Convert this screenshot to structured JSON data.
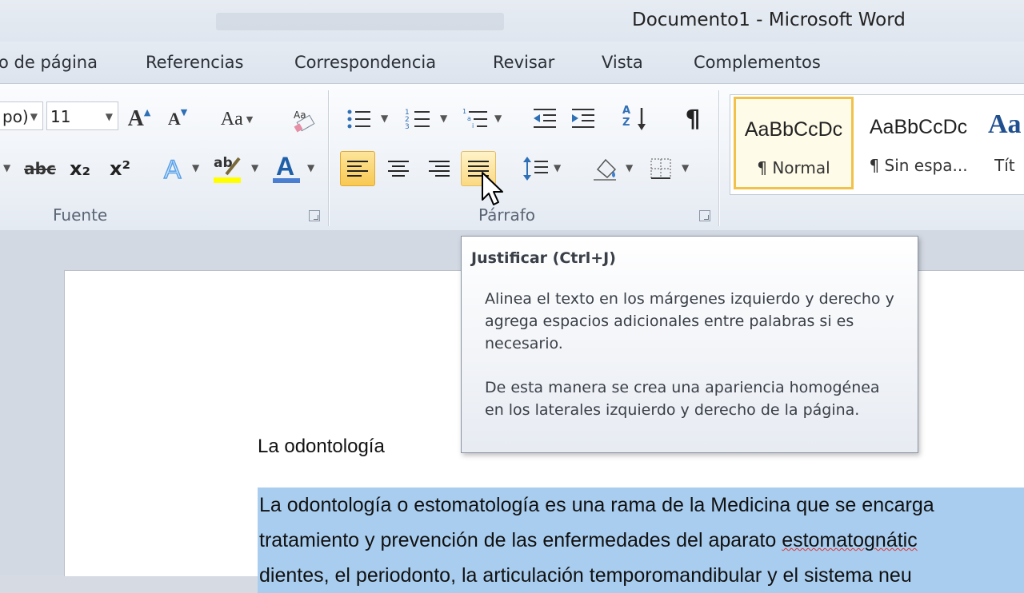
{
  "window": {
    "title": "Documento1  -  Microsoft Word"
  },
  "tabs": [
    {
      "label": "o de página"
    },
    {
      "label": "Referencias"
    },
    {
      "label": "Correspondencia"
    },
    {
      "label": "Revisar"
    },
    {
      "label": "Vista"
    },
    {
      "label": "Complementos"
    }
  ],
  "ribbon": {
    "font": {
      "name_value": "po)",
      "size_value": "11",
      "group_label": "Fuente",
      "grow_label": "A",
      "shrink_label": "A",
      "case_label": "Aa",
      "strike_label": "abc",
      "subscript_label": "x₂",
      "superscript_label": "x²",
      "highlight_label": "ab",
      "font_color_label": "A",
      "highlight_color": "#ffff00",
      "font_color_color": "#d62b2b"
    },
    "paragraph": {
      "group_label": "Párrafo",
      "sort_label": "A Z",
      "marks_label": "¶"
    },
    "styles": [
      {
        "sample": "AaBbCcDc",
        "name": "¶ Normal",
        "selected": true
      },
      {
        "sample": "AaBbCcDc",
        "name": "¶ Sin espa...",
        "selected": false
      },
      {
        "sample": "Aa",
        "name": "Tít",
        "selected": false
      }
    ]
  },
  "tooltip": {
    "title": "Justificar (Ctrl+J)",
    "para1": "Alinea el texto en los márgenes izquierdo y derecho y agrega espacios adicionales entre palabras si es necesario.",
    "para2": "De esta manera se crea una apariencia homogénea en los laterales izquierdo y derecho de la página."
  },
  "document": {
    "heading": "La odontología",
    "line1": "La odontología o estomatología es una rama de la Medicina que se encarga",
    "line2_a": "tratamiento y prevención de las enfermedades del aparato ",
    "line2_b": "estomatognátic",
    "line3": "dientes, el periodonto, la articulación temporomandibular y el sistema neu"
  },
  "colors": {
    "accent_active": "#f8c852",
    "selection": "#a9cdef"
  }
}
